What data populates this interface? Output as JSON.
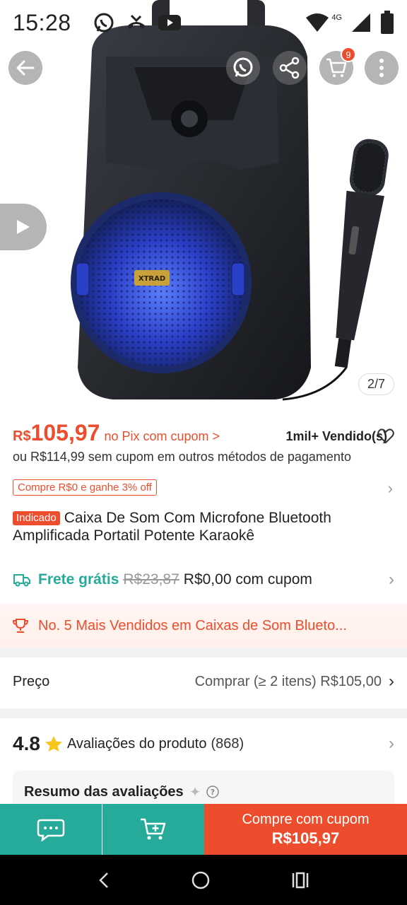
{
  "status_bar": {
    "time": "15:28",
    "network": "4G",
    "left_icons": [
      "whatsapp-icon",
      "missed-call-icon",
      "youtube-icon"
    ],
    "right_icons": [
      "wifi-icon",
      "signal-icon",
      "battery-icon"
    ]
  },
  "header": {
    "cart_badge": "9",
    "image_counter": "2/7"
  },
  "price": {
    "currency": "R$",
    "value": "105,97",
    "note": "no Pix com cupom >",
    "sold": "1mil+ Vendido(s)",
    "alt": "ou R$114,99 sem cupom em outros métodos de pagamento"
  },
  "coupon": {
    "chip": "Compre R$0 e ganhe 3% off"
  },
  "product": {
    "tag": "Indicado",
    "title": "Caixa De Som Com Microfone Bluetooth Amplificada Portatil Potente Karaokê",
    "brand_label": "XTRAD"
  },
  "shipping": {
    "free_label": "Frete grátis",
    "old_price": "R$23,87",
    "new_price": "R$0,00 com cupom"
  },
  "ranking": {
    "text": "No. 5 Mais Vendidos em Caixas de Som Blueto..."
  },
  "price_tier": {
    "label": "Preço",
    "value": "Comprar (≥ 2 itens) R$105,00"
  },
  "rating": {
    "score": "4.8",
    "label": "Avaliações do produto",
    "count": "(868)"
  },
  "review_summary": {
    "title": "Resumo das avaliações"
  },
  "bottom_bar": {
    "buy_line1": "Compre com cupom",
    "buy_line2": "R$105,97"
  },
  "colors": {
    "accent": "#ee4d2d",
    "teal": "#26aa99"
  }
}
